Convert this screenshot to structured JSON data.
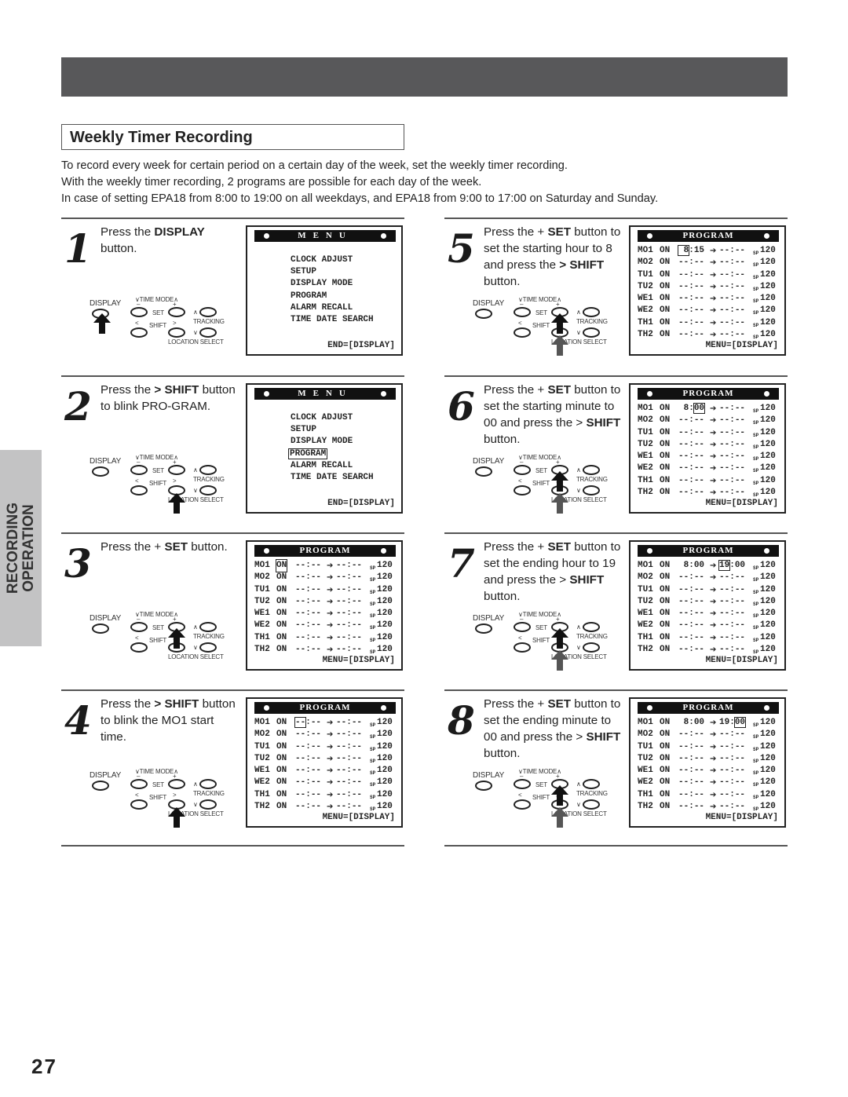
{
  "section_title": "Weekly Timer Recording",
  "intro": [
    "To record every week for certain period on a certain day of the week, set the weekly timer recording.",
    "With the weekly timer recording, 2 programs are possible for each day of the week.",
    "In case of setting EPA18 from 8:00 to 19:00 on all weekdays, and EPA18 from 9:00 to 17:00 on Saturday and Sunday."
  ],
  "side_tab": {
    "line1": "RECORDING",
    "line2": "OPERATION"
  },
  "page_number": "27",
  "remote": {
    "display": "DISPLAY",
    "time_mode": "TIME MODE",
    "set": "SET",
    "shift": "SHIFT",
    "tracking": "TRACKING",
    "location_select": "LOCATION SELECT",
    "minus": "–",
    "plus": "+"
  },
  "menu_screen": {
    "header": "MENU",
    "items": [
      "CLOCK ADJUST",
      "SETUP",
      "DISPLAY MODE",
      "PROGRAM",
      "ALARM RECALL",
      "TIME DATE SEARCH"
    ],
    "footer": "END=[DISPLAY]"
  },
  "program_screen": {
    "header": "PROGRAM",
    "footer": "MENU=[DISPLAY]",
    "speed_prefix": "SP",
    "days": [
      "MO1",
      "MO2",
      "TU1",
      "TU2",
      "WE1",
      "WE2",
      "TH1",
      "TH2"
    ],
    "status": "ON",
    "blank_time": "--:--",
    "arrow": "➔",
    "duration": "120"
  },
  "steps": [
    {
      "number": "1",
      "parts": [
        "Press the ",
        "DISPLAY",
        " button."
      ],
      "screen": "menu",
      "highlight": "none",
      "pressed": [
        "display"
      ]
    },
    {
      "number": "2",
      "parts": [
        "Press the ",
        "> SHIFT",
        " button to blink PRO-GRAM."
      ],
      "screen": "menu",
      "highlight": "PROGRAM",
      "pressed": [
        "shift_right"
      ]
    },
    {
      "number": "3",
      "parts": [
        "Press the + ",
        "SET",
        " button."
      ],
      "screen": "program",
      "mo1_start": "--:--",
      "mo1_end": "--:--",
      "highlight": "on",
      "pressed": [
        "set_plus"
      ]
    },
    {
      "number": "4",
      "parts": [
        "Press the ",
        "> SHIFT",
        " button to blink the MO1 start time."
      ],
      "screen": "program",
      "mo1_start": "--:--",
      "mo1_end": "--:--",
      "highlight": "start_hour",
      "pressed": [
        "shift_right"
      ]
    },
    {
      "number": "5",
      "parts": [
        "Press the + ",
        "SET",
        " button to set the starting hour to 8 and press the ",
        "> SHIFT",
        " button."
      ],
      "screen": "program",
      "mo1_start": "8:15",
      "mo1_end": "--:--",
      "highlight": "start_hour",
      "pressed": [
        "set_plus",
        "shift_right"
      ]
    },
    {
      "number": "6",
      "parts": [
        "Press the + ",
        "SET",
        " button to set the starting minute to 00 and press the > ",
        "SHIFT",
        " button."
      ],
      "screen": "program",
      "mo1_start": "8:00",
      "mo1_end": "--:--",
      "highlight": "start_minute",
      "pressed": [
        "set_plus",
        "shift_right"
      ]
    },
    {
      "number": "7",
      "parts": [
        "Press the + ",
        "SET",
        " button to set the ending hour to 19 and press the > ",
        "SHIFT",
        " button."
      ],
      "screen": "program",
      "mo1_start": "8:00",
      "mo1_end": "19:00",
      "highlight": "end_hour",
      "pressed": [
        "set_plus",
        "shift_right"
      ]
    },
    {
      "number": "8",
      "parts": [
        "Press the + ",
        "SET",
        " button to set the ending minute to 00 and press the > ",
        "SHIFT",
        " button."
      ],
      "screen": "program",
      "mo1_start": "8:00",
      "mo1_end": "19:00",
      "highlight": "end_minute",
      "pressed": [
        "set_plus",
        "shift_right"
      ]
    }
  ]
}
